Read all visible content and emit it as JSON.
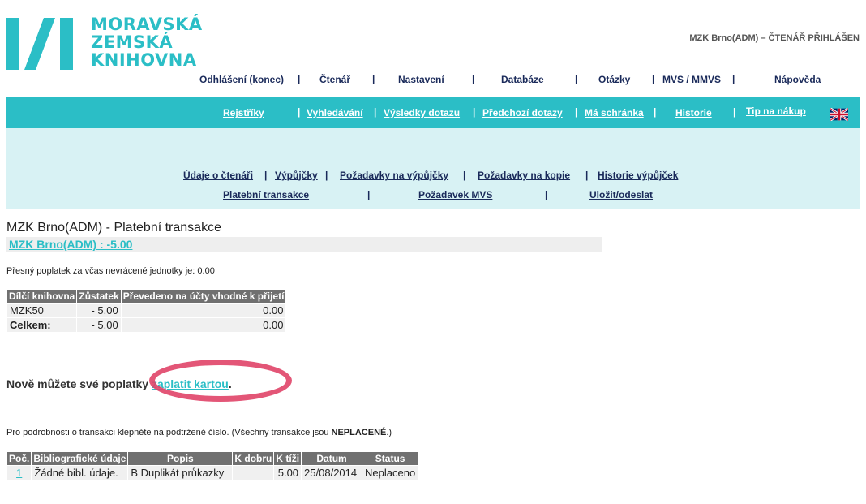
{
  "header": {
    "logo_lines": [
      "MORAVSKÁ",
      "ZEMSKÁ",
      "KNIHOVNA"
    ],
    "user_status": "MZK Brno(ADM) – ČTENÁŘ PŘIHLÁŠEN"
  },
  "top_nav": [
    "Odhlášení (konec)",
    "Čtenář",
    "Nastavení",
    "Databáze",
    "Otázky",
    "MVS / MMVS",
    "Nápověda"
  ],
  "bar_nav": [
    "Rejstříky",
    "Vyhledávání",
    "Výsledky dotazu",
    "Předchozí dotazy",
    "Má schránka",
    "Historie",
    "Tip na nákup"
  ],
  "sub_nav": {
    "row1": [
      "Údaje o čtenáři",
      "Výpůjčky",
      "Požadavky na výpůjčky",
      "Požadavky na kopie",
      "Historie výpůjček"
    ],
    "row2": [
      "Platební transakce",
      "Požadavek MVS",
      "Uložit/odeslat"
    ]
  },
  "page": {
    "title": "MZK Brno(ADM) - Platební transakce",
    "balance_link": "MZK Brno(ADM) : -5.00",
    "fee_note": "Přesný poplatek za včas nevrácené jednotky je: 0.00",
    "card_text_before": "Nově můžete své poplatky ",
    "card_link": "zaplatit kartou",
    "card_text_after": ".",
    "info_before": "Pro podrobnosti o transakci klepněte na podtržené číslo. (Všechny transakce jsou ",
    "info_bold": "NEPLACENÉ",
    "info_after": ".)"
  },
  "summary_table": {
    "headers": [
      "Dílčí knihovna",
      "Zůstatek",
      "Převedeno na účty vhodné k přijetí"
    ],
    "rows": [
      [
        "MZK50",
        "- 5.00",
        "0.00"
      ],
      [
        "Celkem:",
        "- 5.00",
        "0.00"
      ]
    ]
  },
  "transactions_table": {
    "headers": [
      "Poč.",
      "Bibliografické údaje",
      "Popis",
      "K dobru",
      "K tíži",
      "Datum",
      "Status"
    ],
    "rows": [
      [
        "1",
        "Žádné bibl. údaje.",
        "B Duplikát průkazky",
        "",
        "5.00",
        "25/08/2014",
        "Neplaceno"
      ]
    ]
  },
  "colors": {
    "accent": "#2bbec6",
    "light_panel": "#d8f2f4",
    "table_header": "#707070",
    "highlight_ellipse": "#e04468"
  }
}
